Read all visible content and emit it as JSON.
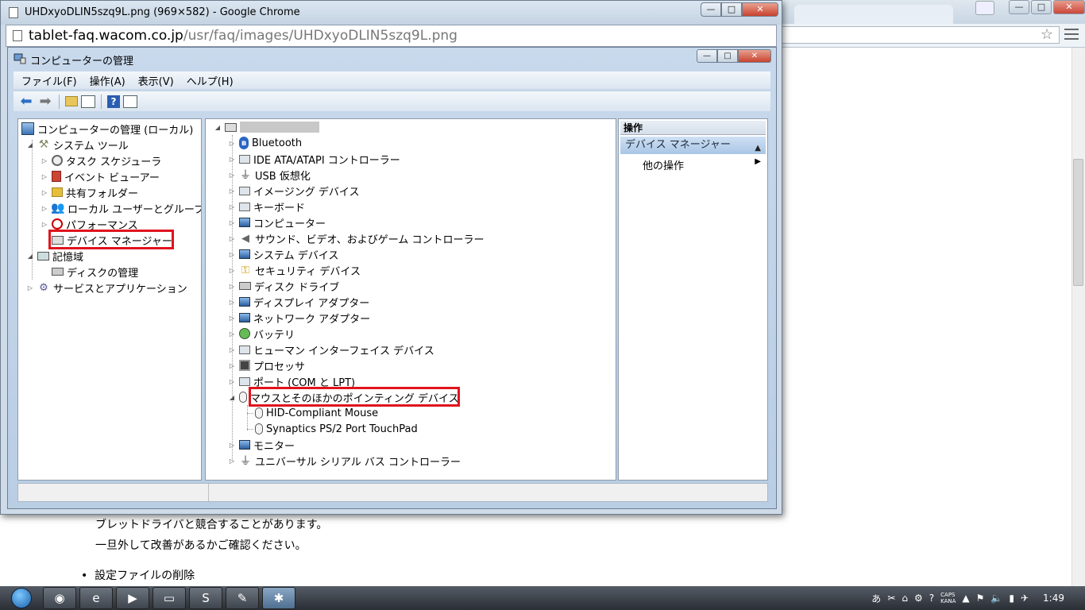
{
  "browser": {
    "title": "UHDxyoDLIN5szq9L.png (969×582) - Google Chrome",
    "url_host": "tablet-faq.wacom.co.jp",
    "url_path": "/usr/faq/images/UHDxyoDLIN5szq9L.png",
    "controls": {
      "minimize": "—",
      "maximize": "□",
      "close": "✕"
    }
  },
  "background_page": {
    "line1": "ブレットドライバと競合することがあります。",
    "line2": "一旦外して改善があるかご確認ください。",
    "bullet": "設定ファイルの削除"
  },
  "mmc": {
    "title": "コンピューターの管理",
    "menus": [
      "ファイル(F)",
      "操作(A)",
      "表示(V)",
      "ヘルプ(H)"
    ],
    "left_tree": [
      {
        "label": "コンピューターの管理 (ローカル)",
        "icon": "computer-management-icon"
      },
      {
        "label": "システム ツール",
        "icon": "tools-icon"
      },
      {
        "label": "タスク スケジューラ",
        "icon": "clock-icon"
      },
      {
        "label": "イベント ビューアー",
        "icon": "event-viewer-icon"
      },
      {
        "label": "共有フォルダー",
        "icon": "shared-folder-icon"
      },
      {
        "label": "ローカル ユーザーとグループ",
        "icon": "users-icon"
      },
      {
        "label": "パフォーマンス",
        "icon": "performance-icon"
      },
      {
        "label": "デバイス マネージャー",
        "icon": "device-manager-icon"
      },
      {
        "label": "記憶域",
        "icon": "storage-icon"
      },
      {
        "label": "ディスクの管理",
        "icon": "disk-icon"
      },
      {
        "label": "サービスとアプリケーション",
        "icon": "services-icon"
      }
    ],
    "device_tree": [
      {
        "label": "Bluetooth",
        "icon": "bluetooth-icon"
      },
      {
        "label": "IDE ATA/ATAPI コントローラー",
        "icon": "ide-icon"
      },
      {
        "label": "USB 仮想化",
        "icon": "usb-icon"
      },
      {
        "label": "イメージング デバイス",
        "icon": "camera-icon"
      },
      {
        "label": "キーボード",
        "icon": "keyboard-icon"
      },
      {
        "label": "コンピューター",
        "icon": "computer-icon"
      },
      {
        "label": "サウンド、ビデオ、およびゲーム コントローラー",
        "icon": "speaker-icon"
      },
      {
        "label": "システム デバイス",
        "icon": "system-device-icon"
      },
      {
        "label": "セキュリティ デバイス",
        "icon": "key-icon"
      },
      {
        "label": "ディスク ドライブ",
        "icon": "disk-drive-icon"
      },
      {
        "label": "ディスプレイ アダプター",
        "icon": "display-adapter-icon"
      },
      {
        "label": "ネットワーク アダプター",
        "icon": "network-adapter-icon"
      },
      {
        "label": "バッテリ",
        "icon": "battery-icon"
      },
      {
        "label": "ヒューマン インターフェイス デバイス",
        "icon": "hid-icon"
      },
      {
        "label": "プロセッサ",
        "icon": "processor-icon"
      },
      {
        "label": "ポート (COM と LPT)",
        "icon": "port-icon"
      },
      {
        "label": "マウスとそのほかのポインティング デバイス",
        "icon": "mouse-icon"
      },
      {
        "label": "HID-Compliant Mouse",
        "icon": "mouse-icon"
      },
      {
        "label": "Synaptics PS/2 Port TouchPad",
        "icon": "mouse-icon"
      },
      {
        "label": "モニター",
        "icon": "monitor-icon"
      },
      {
        "label": "ユニバーサル シリアル バス コントローラー",
        "icon": "usb-icon"
      }
    ],
    "actions": {
      "header": "操作",
      "section": "デバイス マネージャー",
      "other": "他の操作"
    }
  },
  "taskbar": {
    "ime": "あ",
    "caps": "CAPS",
    "kana": "KANA",
    "clock": "1:49"
  },
  "colors": {
    "highlight_red": "#e0141e",
    "accent_blue": "#2a66c4"
  }
}
